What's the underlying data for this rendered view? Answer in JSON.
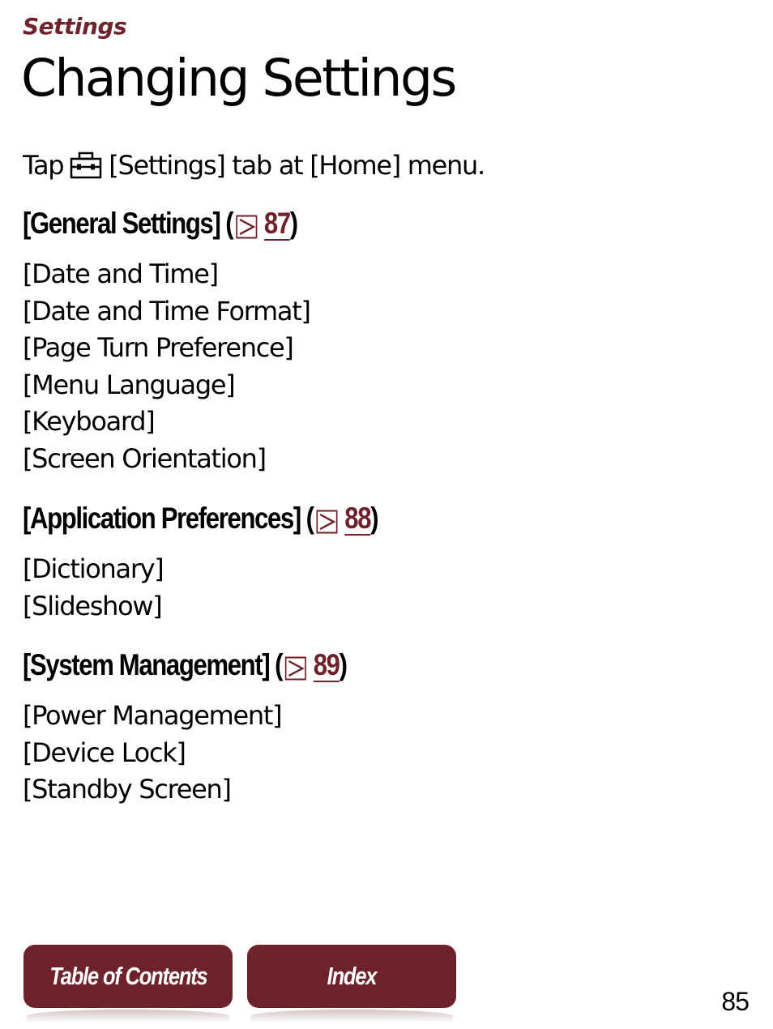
{
  "header": {
    "section": "Settings",
    "title": "Changing Settings"
  },
  "intro": {
    "before_icon": "Tap",
    "icon": "toolbox-icon",
    "after_icon": "[Settings] tab at [Home] menu."
  },
  "sections": [
    {
      "heading": "[General Settings]",
      "open_paren": "(",
      "ref_icon": "arrow-ref-icon",
      "ref_page": "87",
      "close_paren": ")",
      "items": [
        "[Date and Time]",
        "[Date and Time Format]",
        "[Page Turn Preference]",
        "[Menu Language]",
        "[Keyboard]",
        "[Screen Orientation]"
      ]
    },
    {
      "heading": "[Application Preferences]",
      "open_paren": "(",
      "ref_icon": "arrow-ref-icon",
      "ref_page": "88",
      "close_paren": ")",
      "items": [
        "[Dictionary]",
        "[Slideshow]"
      ]
    },
    {
      "heading": "[System Management]",
      "open_paren": "(",
      "ref_icon": "arrow-ref-icon",
      "ref_page": "89",
      "close_paren": ")",
      "items": [
        "[Power Management]",
        "[Device Lock]",
        "[Standby Screen]"
      ]
    }
  ],
  "footer": {
    "toc_label": "Table of Contents",
    "index_label": "Index",
    "page_number": "85"
  },
  "colors": {
    "accent": "#6e222b",
    "text": "#000000",
    "background": "#ffffff"
  }
}
